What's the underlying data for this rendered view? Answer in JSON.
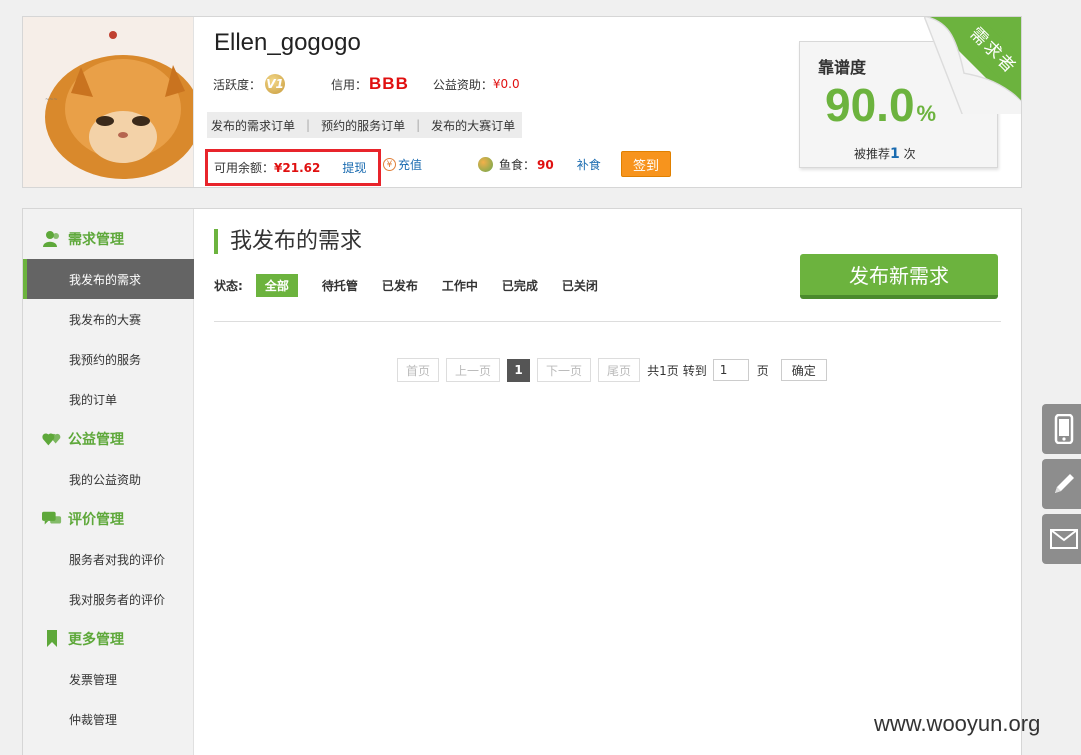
{
  "profile": {
    "username": "Ellen_gogogo",
    "activity_label": "活跃度：",
    "activity_badge": "V1",
    "credit_label": "信用：",
    "credit_value": "BBB",
    "donation_label": "公益资助：",
    "donation_value": "¥0.0",
    "order_links": [
      "发布的需求订单",
      "预约的服务订单",
      "发布的大赛订单"
    ],
    "balance_label": "可用余额：",
    "balance_value": "¥21.62",
    "withdraw_label": "提现",
    "recharge_label": "充值",
    "fishfood_label": "鱼食：",
    "fishfood_value": "90",
    "feed_label": "补食",
    "checkin_label": "签到"
  },
  "reliability": {
    "title": "靠谱度",
    "score": "90.0",
    "percent": "%",
    "recommend_prefix": "被推荐",
    "recommend_count": "1",
    "recommend_suffix": "次",
    "ribbon": "需求者"
  },
  "sidebar": {
    "groups": [
      {
        "label": "需求管理",
        "icon": "user-group-icon",
        "items": [
          "我发布的需求",
          "我发布的大赛",
          "我预约的服务",
          "我的订单"
        ]
      },
      {
        "label": "公益管理",
        "icon": "hearts-icon",
        "items": [
          "我的公益资助"
        ]
      },
      {
        "label": "评价管理",
        "icon": "speech-bubbles-icon",
        "items": [
          "服务者对我的评价",
          "我对服务者的评价"
        ]
      },
      {
        "label": "更多管理",
        "icon": "bookmark-icon",
        "items": [
          "发票管理",
          "仲裁管理"
        ]
      }
    ],
    "active_item": "我发布的需求"
  },
  "content": {
    "title": "我发布的需求",
    "status_label": "状态:",
    "filters": [
      "全部",
      "待托管",
      "已发布",
      "工作中",
      "已完成",
      "已关闭"
    ],
    "active_filter": "全部",
    "publish_button": "发布新需求"
  },
  "pager": {
    "first": "首页",
    "prev": "上一页",
    "current": "1",
    "next": "下一页",
    "last": "尾页",
    "total": "共1页",
    "goto_label": "转到",
    "goto_value": "1",
    "page_unit": "页",
    "confirm": "确定"
  },
  "tools": [
    "phone-icon",
    "pencil-icon",
    "mail-icon"
  ],
  "watermark": "www.wooyun.org",
  "colors": {
    "accent": "#6cb33e",
    "price": "#e01010",
    "link": "#1a6bb0",
    "checkin": "#f7941d",
    "highlight_border": "#e8242b"
  }
}
